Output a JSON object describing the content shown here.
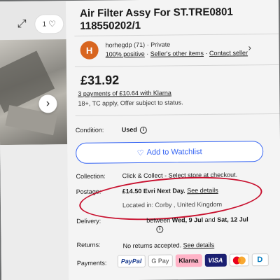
{
  "listing": {
    "title": "Air Filter Assy For ST.TRE0801 118550202/1",
    "watch_count": "1"
  },
  "seller": {
    "avatar_letter": "H",
    "name": "horhegdp",
    "feedback": "(71)",
    "type": "· Private",
    "positive": "100% positive",
    "other_items": "Seller's other items",
    "contact": "Contact seller"
  },
  "price": {
    "amount": "£31.92",
    "klarna": "3 payments of £10.64 with Klarna",
    "note": "18+, TC apply, Offer subject to status."
  },
  "details": {
    "condition_label": "Condition:",
    "condition_value": "Used",
    "watchlist_label": "Add to Watchlist",
    "collection_label": "Collection:",
    "collection_value": "Click & Collect - Select store at checkout.",
    "postage_label": "Postage:",
    "postage_price": "£14.50 Evri Next Day.",
    "postage_link": "See details",
    "location": "Located in: Corby , United Kingdom",
    "delivery_label": "Delivery:",
    "delivery_prefix": "between",
    "delivery_start": "Wed, 9 Jul",
    "delivery_and": "and",
    "delivery_end": "Sat, 12 Jul",
    "returns_label": "Returns:",
    "returns_value": "No returns accepted.",
    "returns_link": "See details",
    "payments_label": "Payments:"
  },
  "payments": [
    "PayPal",
    "G Pay",
    "Klarna",
    "VISA",
    "",
    "D"
  ],
  "colors": {
    "link_blue": "#3665f3",
    "annotation_red": "#c8102e",
    "avatar_orange": "#d8651f"
  }
}
